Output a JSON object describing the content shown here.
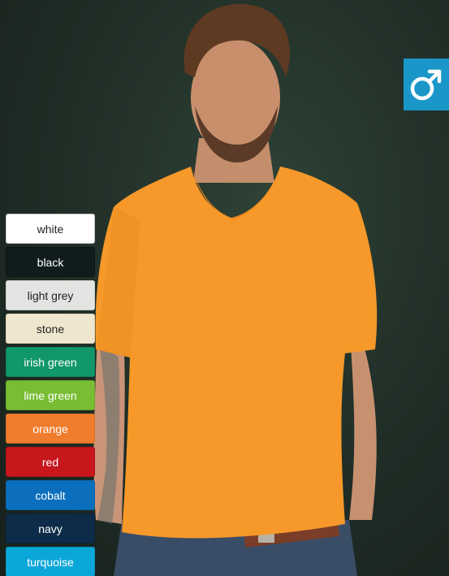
{
  "gender_badge": {
    "icon": "male-symbol-icon",
    "color": "#1a97c8"
  },
  "swatches": [
    {
      "label": "white",
      "bg": "#ffffff",
      "fg": "#222222",
      "border": "#c8c8c8"
    },
    {
      "label": "black",
      "bg": "#101c1c",
      "fg": "#ffffff",
      "border": "#0b1414"
    },
    {
      "label": "light grey",
      "bg": "#e3e3e1",
      "fg": "#222222",
      "border": "#cfcfcc"
    },
    {
      "label": "stone",
      "bg": "#efe6cf",
      "fg": "#222222",
      "border": "#ddd2b6"
    },
    {
      "label": "irish green",
      "bg": "#11976a",
      "fg": "#ffffff",
      "border": "#0d855d"
    },
    {
      "label": "lime green",
      "bg": "#78bd33",
      "fg": "#ffffff",
      "border": "#6aaa2b"
    },
    {
      "label": "orange",
      "bg": "#ef7d2d",
      "fg": "#ffffff",
      "border": "#dc6e20"
    },
    {
      "label": "red",
      "bg": "#c8161d",
      "fg": "#ffffff",
      "border": "#b31218"
    },
    {
      "label": "cobalt",
      "bg": "#0b6fbd",
      "fg": "#ffffff",
      "border": "#0962a8"
    },
    {
      "label": "navy",
      "bg": "#0e2c49",
      "fg": "#ffffff",
      "border": "#0a2239"
    },
    {
      "label": "turquoise",
      "bg": "#0ca7d9",
      "fg": "#ffffff",
      "border": "#0996c3"
    }
  ]
}
